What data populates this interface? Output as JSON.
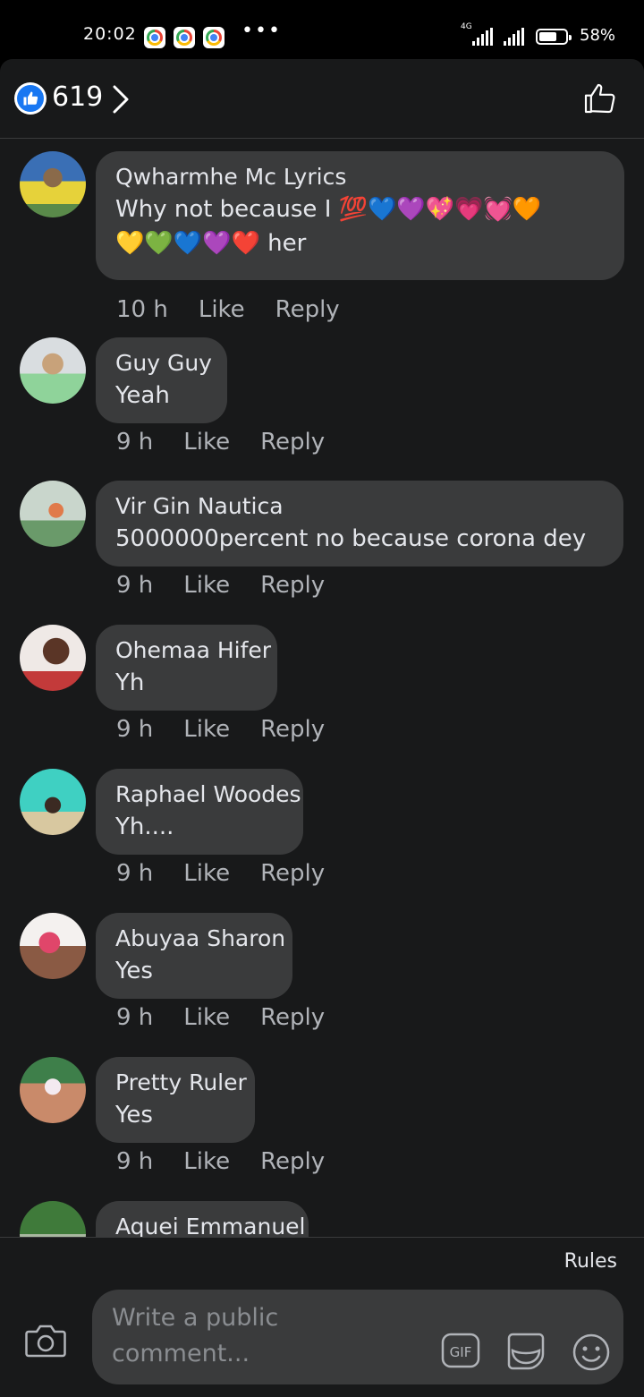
{
  "status_bar": {
    "time": "20:02",
    "more": "•••",
    "network": "4G",
    "battery": "58%"
  },
  "header": {
    "like_count": "619"
  },
  "comments": [
    {
      "name": "Qwharmhe Mc Lyrics",
      "text_line1": "Why not because I 💯💙💜💖💗💓🧡",
      "text_line2": "💛💚💙💜❤️ her",
      "time": "10 h",
      "like": "Like",
      "reply": "Reply"
    },
    {
      "name": "Guy Guy",
      "text": "Yeah",
      "time": "9 h",
      "like": "Like",
      "reply": "Reply"
    },
    {
      "name": "Vir Gin Nautica",
      "text": "5000000percent no because corona dey",
      "time": "9 h",
      "like": "Like",
      "reply": "Reply"
    },
    {
      "name": "Ohemaa Hifer",
      "text": "Yh",
      "time": "9 h",
      "like": "Like",
      "reply": "Reply"
    },
    {
      "name": "Raphael Woodes",
      "text": "Yh....",
      "time": "9 h",
      "like": "Like",
      "reply": "Reply"
    },
    {
      "name": "Abuyaa Sharon",
      "text": "Yes",
      "time": "9 h",
      "like": "Like",
      "reply": "Reply"
    },
    {
      "name": "Pretty Ruler",
      "text": "Yes",
      "time": "9 h",
      "like": "Like",
      "reply": "Reply"
    },
    {
      "name": "Aquei Emmanuel"
    }
  ],
  "footer": {
    "rules": "Rules",
    "placeholder": "Write a public comment...",
    "gif": "GIF"
  },
  "icons": {
    "like_badge": "thumbs-up-icon",
    "chevron": "chevron-right-icon",
    "like_button": "thumbs-up-outline-icon",
    "camera": "camera-icon",
    "gif": "gif-icon",
    "sticker": "sticker-icon",
    "emoji": "emoji-icon"
  },
  "colors": {
    "background": "#18191a",
    "bubble": "#3a3b3c",
    "accent": "#1877f2",
    "secondary_text": "#b0b3b8"
  }
}
